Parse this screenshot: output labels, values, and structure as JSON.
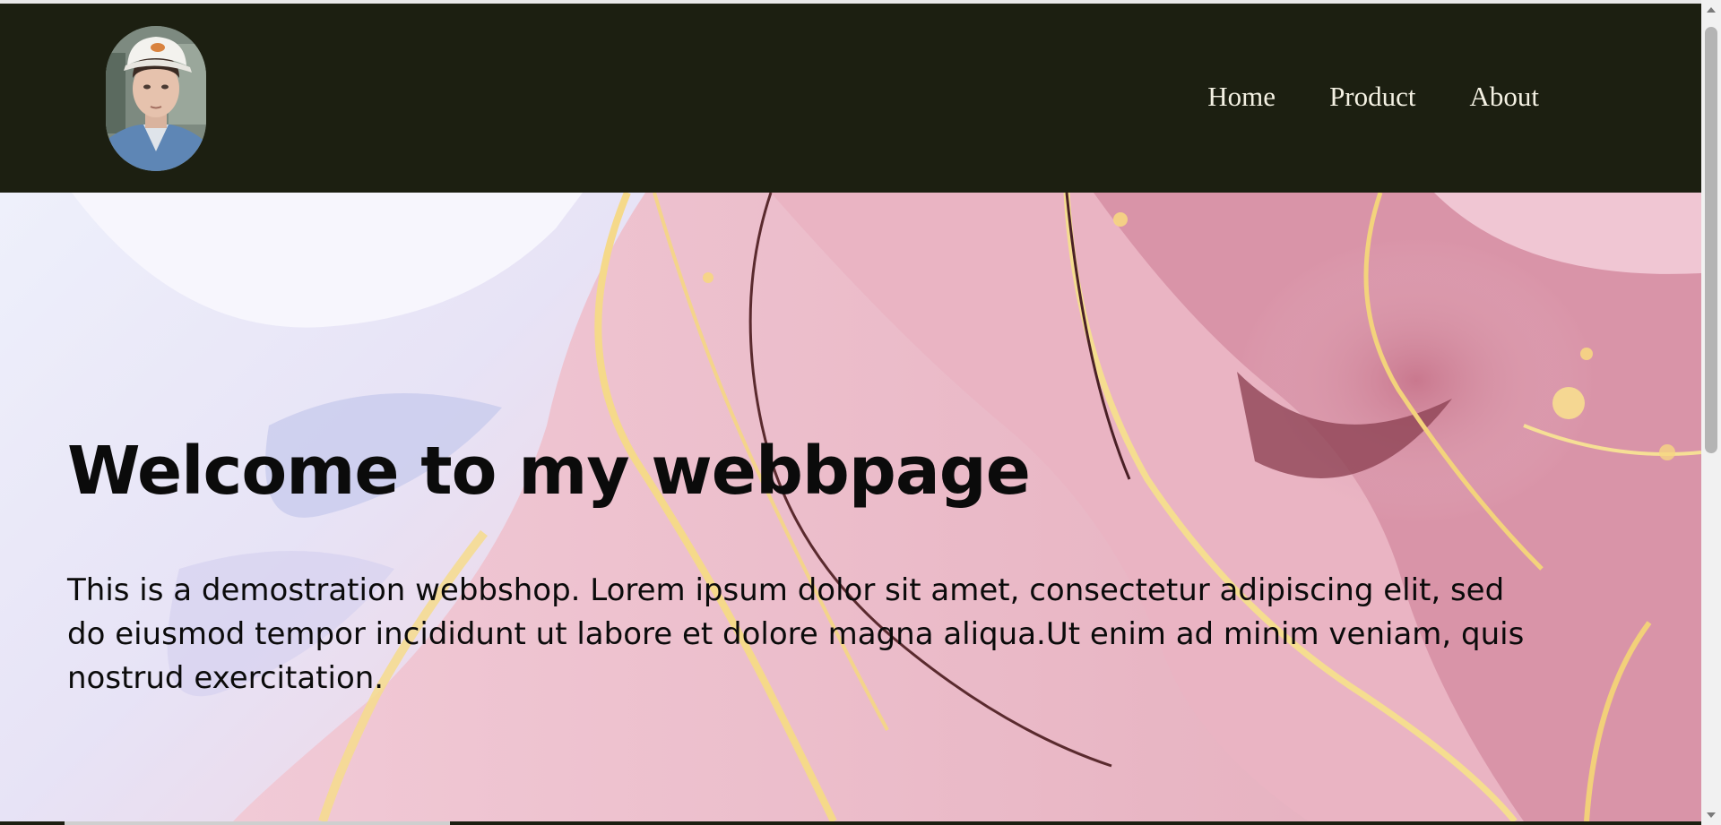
{
  "header": {
    "avatar_alt": "profile photo",
    "nav": [
      {
        "label": "Home"
      },
      {
        "label": "Product"
      },
      {
        "label": "About"
      }
    ],
    "background_color": "#1c1f11"
  },
  "hero": {
    "title": "Welcome to my webbpage",
    "text": "This is a demostration webbshop. Lorem ipsum dolor sit amet, consectetur adipiscing elit, sed do eiusmod tempor incididunt ut labore et dolore magna aliqua.Ut enim ad minim veniam, quis nostrud exercitation.",
    "background": "pink-gold-marble-image"
  },
  "scrollbar": {
    "position_fraction": 0.0
  }
}
